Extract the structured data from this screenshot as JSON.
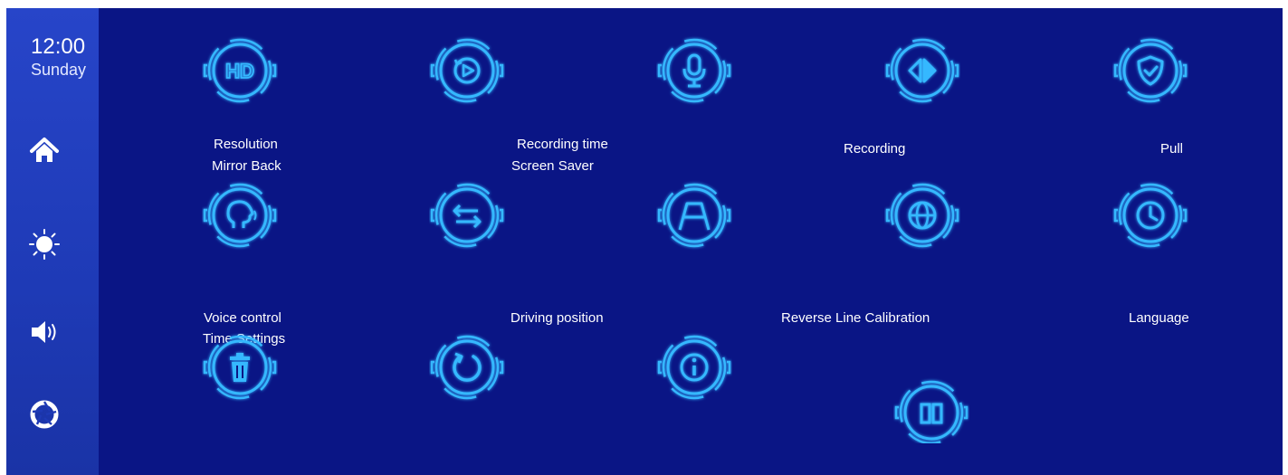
{
  "status": {
    "time": "12:00",
    "day": "Sunday"
  },
  "sidebar": {
    "items": [
      "home-icon",
      "brightness-icon",
      "volume-icon",
      "shutter-icon"
    ]
  },
  "grid": {
    "icons": [
      "hd-icon",
      "replay-icon",
      "microphone-icon",
      "mirror-arrows-icon",
      "shield-icon",
      "voice-head-icon",
      "swap-arrows-icon",
      "ramp-icon",
      "globe-icon",
      "clock-icon",
      "trash-icon",
      "refresh-icon",
      "info-icon",
      "columns-icon"
    ],
    "labels": {
      "resolution": "Resolution",
      "mirror_back": "Mirror Back",
      "recording_time": "Recording time",
      "screen_saver": "Screen Saver",
      "recording": "Recording",
      "pull": "Pull",
      "voice_control": "Voice control",
      "time_settings": "Time Settings",
      "driving_position": "Driving position",
      "reverse_line_calibration": "Reverse Line Calibration",
      "language": "Language"
    }
  },
  "colors": {
    "background": "#0a1585",
    "sidebar": "#1e3ab6",
    "icon_glow": "#35b8ff",
    "text": "#ffffff"
  }
}
